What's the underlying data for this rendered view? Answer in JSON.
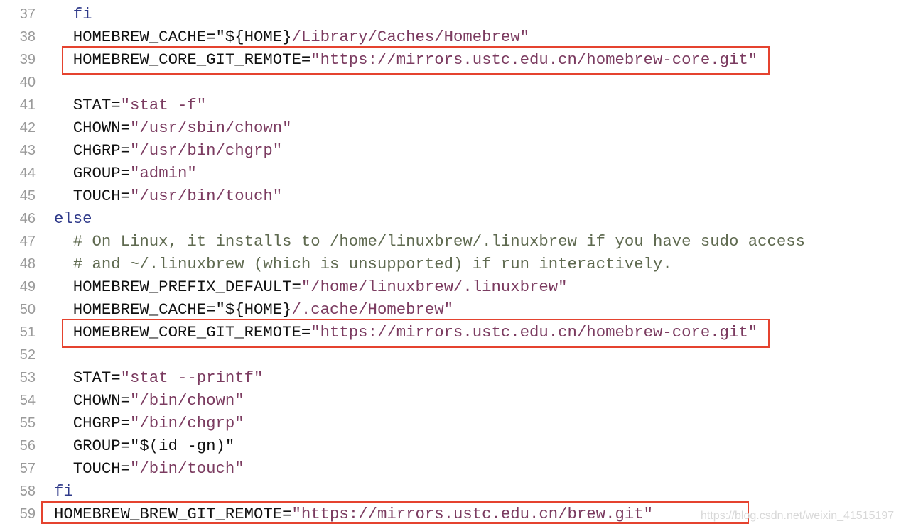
{
  "colors": {
    "keyword": "#2f3a8a",
    "string": "#7b3b60",
    "comment": "#5f6a50",
    "highlight_box": "#e5432f"
  },
  "lines": [
    {
      "n": "37",
      "seg": [
        [
          "plain",
          "  "
        ],
        [
          "kw",
          "fi"
        ]
      ]
    },
    {
      "n": "38",
      "seg": [
        [
          "plain",
          "  HOMEBREW_CACHE=\"${HOME}"
        ],
        [
          "str",
          "/Library/Caches/Homebrew\""
        ]
      ]
    },
    {
      "n": "39",
      "seg": [
        [
          "plain",
          "  HOMEBREW_CORE_GIT_REMOTE="
        ],
        [
          "str",
          "\"https://mirrors.ustc.edu.cn/homebrew-core.git\""
        ]
      ]
    },
    {
      "n": "40",
      "seg": []
    },
    {
      "n": "41",
      "seg": [
        [
          "plain",
          "  STAT="
        ],
        [
          "str",
          "\"stat -f\""
        ]
      ]
    },
    {
      "n": "42",
      "seg": [
        [
          "plain",
          "  CHOWN="
        ],
        [
          "str",
          "\"/usr/sbin/chown\""
        ]
      ]
    },
    {
      "n": "43",
      "seg": [
        [
          "plain",
          "  CHGRP="
        ],
        [
          "str",
          "\"/usr/bin/chgrp\""
        ]
      ]
    },
    {
      "n": "44",
      "seg": [
        [
          "plain",
          "  GROUP="
        ],
        [
          "str",
          "\"admin\""
        ]
      ]
    },
    {
      "n": "45",
      "seg": [
        [
          "plain",
          "  TOUCH="
        ],
        [
          "str",
          "\"/usr/bin/touch\""
        ]
      ]
    },
    {
      "n": "46",
      "seg": [
        [
          "kw",
          "else"
        ]
      ]
    },
    {
      "n": "47",
      "seg": [
        [
          "cmt",
          "  # On Linux, it installs to /home/linuxbrew/.linuxbrew if you have sudo access"
        ]
      ]
    },
    {
      "n": "48",
      "seg": [
        [
          "cmt",
          "  # and ~/.linuxbrew (which is unsupported) if run interactively."
        ]
      ]
    },
    {
      "n": "49",
      "seg": [
        [
          "plain",
          "  HOMEBREW_PREFIX_DEFAULT="
        ],
        [
          "str",
          "\"/home/linuxbrew/.linuxbrew\""
        ]
      ]
    },
    {
      "n": "50",
      "seg": [
        [
          "plain",
          "  HOMEBREW_CACHE=\"${HOME}"
        ],
        [
          "str",
          "/.cache/Homebrew\""
        ]
      ]
    },
    {
      "n": "51",
      "seg": [
        [
          "plain",
          "  HOMEBREW_CORE_GIT_REMOTE="
        ],
        [
          "str",
          "\"https://mirrors.ustc.edu.cn/homebrew-core.git\""
        ]
      ]
    },
    {
      "n": "52",
      "seg": []
    },
    {
      "n": "53",
      "seg": [
        [
          "plain",
          "  STAT="
        ],
        [
          "str",
          "\"stat --printf\""
        ]
      ]
    },
    {
      "n": "54",
      "seg": [
        [
          "plain",
          "  CHOWN="
        ],
        [
          "str",
          "\"/bin/chown\""
        ]
      ]
    },
    {
      "n": "55",
      "seg": [
        [
          "plain",
          "  CHGRP="
        ],
        [
          "str",
          "\"/bin/chgrp\""
        ]
      ]
    },
    {
      "n": "56",
      "seg": [
        [
          "plain",
          "  GROUP=\"$(id -gn)\""
        ]
      ]
    },
    {
      "n": "57",
      "seg": [
        [
          "plain",
          "  TOUCH="
        ],
        [
          "str",
          "\"/bin/touch\""
        ]
      ]
    },
    {
      "n": "58",
      "seg": [
        [
          "kw",
          "fi"
        ]
      ]
    },
    {
      "n": "59",
      "seg": [
        [
          "plain",
          "HOMEBREW_BREW_GIT_REMOTE="
        ],
        [
          "str",
          "\"https://mirrors.ustc.edu.cn/brew.git\""
        ]
      ]
    }
  ],
  "highlighted_lines": [
    "39",
    "51",
    "59"
  ],
  "watermark": "https://blog.csdn.net/weixin_41515197"
}
